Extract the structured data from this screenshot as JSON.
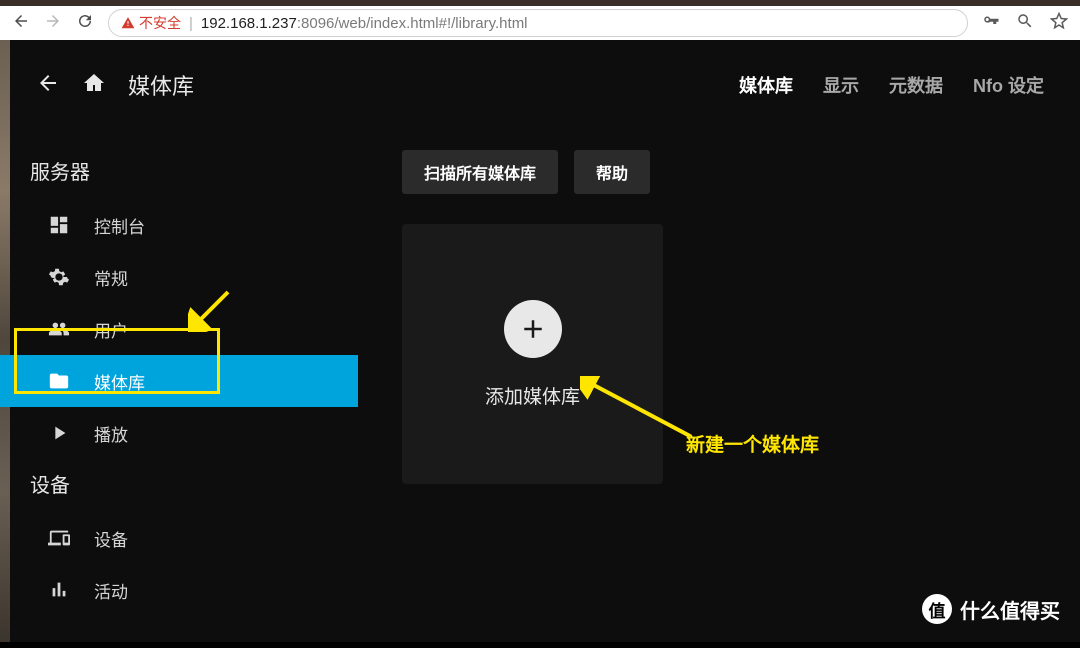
{
  "browser": {
    "insecure_label": "不安全",
    "url_host": "192.168.1.237",
    "url_port": ":8096",
    "url_path": "/web/index.html#!/library.html"
  },
  "header": {
    "title": "媒体库",
    "tabs": [
      {
        "label": "媒体库",
        "active": true
      },
      {
        "label": "显示",
        "active": false
      },
      {
        "label": "元数据",
        "active": false
      },
      {
        "label": "Nfo 设定",
        "active": false
      }
    ]
  },
  "sidebar": {
    "sections": [
      {
        "heading": "服务器",
        "items": [
          {
            "icon": "dashboard-icon",
            "label": "控制台"
          },
          {
            "icon": "gear-icon",
            "label": "常规"
          },
          {
            "icon": "users-icon",
            "label": "用户"
          },
          {
            "icon": "folder-icon",
            "label": "媒体库",
            "active": true
          },
          {
            "icon": "play-icon",
            "label": "播放"
          }
        ]
      },
      {
        "heading": "设备",
        "items": [
          {
            "icon": "devices-icon",
            "label": "设备"
          },
          {
            "icon": "activity-icon",
            "label": "活动"
          }
        ]
      }
    ]
  },
  "main": {
    "scan_button": "扫描所有媒体库",
    "help_button": "帮助",
    "add_card_label": "添加媒体库"
  },
  "annotations": {
    "new_library_text": "新建一个媒体库"
  },
  "watermark": {
    "badge": "值",
    "text": "什么值得买"
  }
}
